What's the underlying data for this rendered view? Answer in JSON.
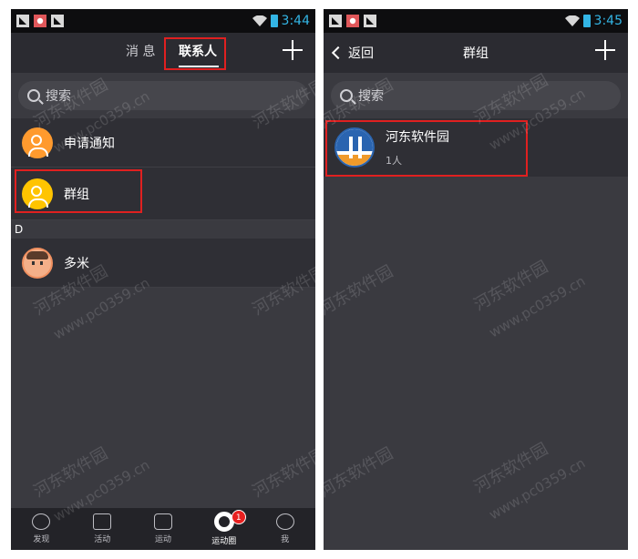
{
  "left": {
    "status": {
      "time": "3:44"
    },
    "tabs": [
      {
        "label": "消 息"
      },
      {
        "label": "联系人"
      }
    ],
    "search": {
      "placeholder": "搜索"
    },
    "items": [
      {
        "label": "申请通知"
      },
      {
        "label": "群组"
      }
    ],
    "section_d": {
      "letter": "D"
    },
    "contacts": [
      {
        "name": "多米"
      }
    ],
    "nav": [
      {
        "label": "发现"
      },
      {
        "label": "活动"
      },
      {
        "label": "运动"
      },
      {
        "label": "运动圈",
        "badge": "1"
      },
      {
        "label": "我"
      }
    ]
  },
  "right": {
    "status": {
      "time": "3:45"
    },
    "back_label": "返回",
    "title": "群组",
    "search": {
      "placeholder": "搜索"
    },
    "groups": [
      {
        "name": "河东软件园",
        "count": "1人"
      }
    ]
  },
  "watermark": {
    "line1": "河东软件园",
    "line2": "www.pc0359.cn"
  },
  "colors": {
    "accent_time": "#33b5e5",
    "highlight": "#e02020",
    "badge": "#e82020"
  }
}
